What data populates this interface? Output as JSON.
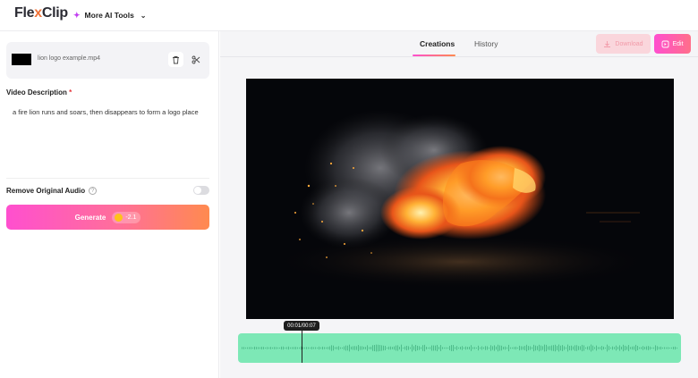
{
  "header": {
    "logo_text": "FlexClip",
    "tools_label": "More AI Tools"
  },
  "left": {
    "file_name": "lion logo example.mp4",
    "description_label": "Video Description",
    "required_mark": "*",
    "description_text": "a fire lion runs and soars, then disappears to form a logo place",
    "audio_label": "Remove Original Audio",
    "audio_removed": false,
    "generate_label": "Generate",
    "credit_cost": "-2.1"
  },
  "right": {
    "tabs": [
      {
        "label": "Creations",
        "active": true
      },
      {
        "label": "History",
        "active": false
      }
    ],
    "download_label": "Download",
    "edit_label": "Edit",
    "time_readout": "00:01/00:07",
    "playhead_fraction": 0.143
  },
  "colors": {
    "accent_gradient_start": "#ff4fcf",
    "accent_gradient_end": "#ff8a4f",
    "waveform": "#7de8b6"
  },
  "icons": {
    "tools": "sparkle-icon",
    "trash": "trash-icon",
    "scissors": "scissors-icon",
    "help": "help-icon",
    "download": "download-icon",
    "edit": "edit-icon"
  }
}
